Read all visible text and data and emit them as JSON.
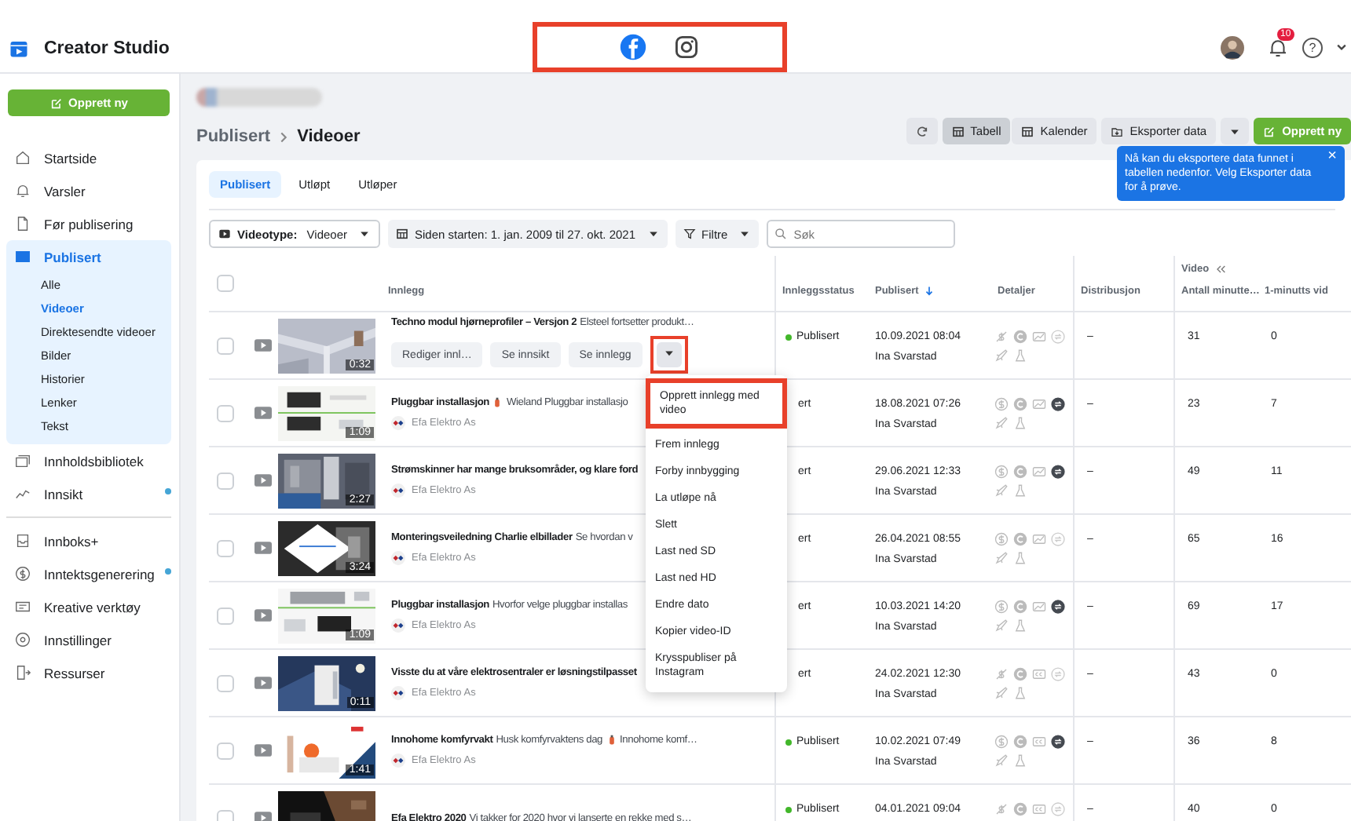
{
  "app": {
    "title": "Creator Studio"
  },
  "platform_switcher": {
    "highlighted": true
  },
  "platforms": [
    {
      "kind": "facebook",
      "selected": true
    },
    {
      "kind": "instagram",
      "selected": false
    }
  ],
  "header": {
    "notification_count": "10",
    "help_label": "?"
  },
  "sidebar": {
    "create_button": "Opprett ny",
    "items": [
      {
        "kind": "home",
        "label": "Startside",
        "selected": false,
        "badge": false
      },
      {
        "kind": "bell",
        "label": "Varsler",
        "selected": false,
        "badge": false
      },
      {
        "kind": "doc",
        "label": "Før publisering",
        "selected": false,
        "badge": false
      },
      {
        "kind": "publish",
        "label": "Publisert",
        "selected": true,
        "badge": false,
        "expanded": true,
        "children": [
          {
            "label": "Alle",
            "selected": false
          },
          {
            "label": "Videoer",
            "selected": true
          },
          {
            "label": "Direktesendte videoer",
            "selected": false
          },
          {
            "label": "Bilder",
            "selected": false
          },
          {
            "label": "Historier",
            "selected": false
          },
          {
            "label": "Lenker",
            "selected": false
          },
          {
            "label": "Tekst",
            "selected": false
          }
        ]
      },
      {
        "kind": "library",
        "label": "Innholdsbibliotek",
        "selected": false,
        "badge": false
      },
      {
        "kind": "insights",
        "label": "Innsikt",
        "selected": false,
        "badge": true
      },
      {
        "kind": "divider"
      },
      {
        "kind": "inbox",
        "label": "Innboks+",
        "selected": false,
        "badge": false
      },
      {
        "kind": "money",
        "label": "Inntektsgenerering",
        "selected": false,
        "badge": true
      },
      {
        "kind": "creative",
        "label": "Kreative verktøy",
        "selected": false,
        "badge": false
      },
      {
        "kind": "settings",
        "label": "Innstillinger",
        "selected": false,
        "badge": false
      },
      {
        "kind": "resources",
        "label": "Ressurser",
        "selected": false,
        "badge": false
      }
    ]
  },
  "breadcrumb": [
    "Publisert",
    "Videoer"
  ],
  "toolbar": {
    "views": [
      {
        "label": "Tabell",
        "selected": true
      },
      {
        "label": "Kalender",
        "selected": false
      }
    ],
    "export": "Eksporter data",
    "create": "Opprett ny"
  },
  "tooltip": {
    "text": "Nå kan du eksportere data funnet i tabellen nedenfor. Velg Eksporter data for å prøve.",
    "close": "×"
  },
  "tabs": [
    {
      "label": "Publisert",
      "selected": true
    },
    {
      "label": "Utløpt",
      "selected": false
    },
    {
      "label": "Utløper",
      "selected": false
    }
  ],
  "filters": [
    {
      "kind": "videotype",
      "label": "Videotype:",
      "value": "Videoer"
    },
    {
      "kind": "date",
      "value": "Siden starten: 1. jan. 2009 til 27. okt. 2021"
    },
    {
      "kind": "filter",
      "value": "Filtre"
    }
  ],
  "search": {
    "placeholder": "Søk"
  },
  "table": {
    "select_all": {
      "checked": false
    },
    "group_header": "Video",
    "columns": [
      {
        "label": "Innlegg",
        "sorted": false
      },
      {
        "label": "Innleggsstatus",
        "sorted": false
      },
      {
        "label": "Publisert",
        "sorted": true
      },
      {
        "label": "Detaljer",
        "sorted": false
      },
      {
        "label": "Distribusjon",
        "sorted": false
      },
      {
        "label": "Antall minutte…",
        "sorted": false
      },
      {
        "label": "1-minutts vid",
        "sorted": false
      }
    ],
    "rows": [
      {
        "checked": false,
        "duration": "0:32",
        "title": "Techno modul hjørneprofiler – Versjon 2",
        "segments": [
          {
            "kind": "text",
            "text": "Elsteel fortsetter produkt…"
          }
        ],
        "actions": [
          "Rediger innl…",
          "Se innsikt",
          "Se innlegg"
        ],
        "menu_button": {
          "highlighted": true
        },
        "status": "Publisert",
        "status_dot": true,
        "date": "10.09.2021 08:04",
        "publisher": "Ina Svarstad",
        "details": {
          "monetization": false,
          "captions": false,
          "crossposted": false
        },
        "distribution": "–",
        "minutes": "31",
        "one_minute": "0"
      },
      {
        "checked": false,
        "duration": "1:09",
        "title": "Pluggbar installasjon",
        "segments": [
          {
            "kind": "emoji"
          },
          {
            "kind": "text",
            "text": "Wieland Pluggbar installasjo"
          }
        ],
        "author": "Efa Elektro As",
        "status": "ert",
        "status_dot": false,
        "date": "18.08.2021 07:26",
        "publisher": "Ina Svarstad",
        "details": {
          "monetization": true,
          "captions": false,
          "crossposted": true
        },
        "distribution": "–",
        "minutes": "23",
        "one_minute": "7"
      },
      {
        "checked": false,
        "duration": "2:27",
        "title": "Strømskinner har mange bruksområder, og klare ford",
        "segments": [],
        "author": "Efa Elektro As",
        "status": "ert",
        "status_dot": false,
        "date": "29.06.2021 12:33",
        "publisher": "Ina Svarstad",
        "details": {
          "monetization": true,
          "captions": false,
          "crossposted": true
        },
        "distribution": "–",
        "minutes": "49",
        "one_minute": "11"
      },
      {
        "checked": false,
        "duration": "3:24",
        "title": "Monteringsveiledning Charlie elbillader",
        "segments": [
          {
            "kind": "text",
            "text": "Se hvordan v"
          }
        ],
        "author": "Efa Elektro As",
        "status": "ert",
        "status_dot": false,
        "date": "26.04.2021 08:55",
        "publisher": "Ina Svarstad",
        "details": {
          "monetization": true,
          "captions": false,
          "crossposted": false
        },
        "distribution": "–",
        "minutes": "65",
        "one_minute": "16"
      },
      {
        "checked": false,
        "duration": "1:09",
        "title": "Pluggbar installasjon",
        "segments": [
          {
            "kind": "text",
            "text": "Hvorfor velge pluggbar installas"
          }
        ],
        "author": "Efa Elektro As",
        "status": "ert",
        "status_dot": false,
        "date": "10.03.2021 14:20",
        "publisher": "Ina Svarstad",
        "details": {
          "monetization": true,
          "captions": false,
          "crossposted": true
        },
        "distribution": "–",
        "minutes": "69",
        "one_minute": "17"
      },
      {
        "checked": false,
        "duration": "0:11",
        "title": "Visste du at våre elektrosentraler er løsningstilpasset",
        "segments": [],
        "author": "Efa Elektro As",
        "status": "ert",
        "status_dot": false,
        "date": "24.02.2021 12:30",
        "publisher": "Ina Svarstad",
        "details": {
          "monetization": false,
          "captions": true,
          "crossposted": false
        },
        "distribution": "–",
        "minutes": "43",
        "one_minute": "0"
      },
      {
        "checked": false,
        "duration": "1:41",
        "title": "Innohome komfyrvakt",
        "segments": [
          {
            "kind": "text",
            "text": "Husk komfyrvaktens dag"
          },
          {
            "kind": "emoji"
          },
          {
            "kind": "text",
            "text": "Innohome komf…"
          }
        ],
        "author": "Efa Elektro As",
        "status": "Publisert",
        "status_dot": true,
        "date": "10.02.2021 07:49",
        "publisher": "Ina Svarstad",
        "details": {
          "monetization": true,
          "captions": true,
          "crossposted": true
        },
        "distribution": "–",
        "minutes": "36",
        "one_minute": "8"
      },
      {
        "checked": false,
        "title": "Efa Elektro 2020",
        "segments": [
          {
            "kind": "text",
            "text": "Vi takker for 2020 hvor vi lanserte en rekke med s…"
          }
        ],
        "status": "Publisert",
        "status_dot": true,
        "date": "04.01.2021 09:04",
        "details": {
          "monetization": false,
          "captions": true,
          "crossposted": false
        },
        "distribution": "–",
        "minutes": "40",
        "one_minute": "0"
      }
    ]
  },
  "menu": {
    "items": [
      {
        "label": "Opprett innlegg med video",
        "highlighted": true
      },
      {
        "label": "Frem innlegg",
        "highlighted": false
      },
      {
        "label": "Forby innbygging",
        "highlighted": false
      },
      {
        "label": "La utløpe nå",
        "highlighted": false
      },
      {
        "label": "Slett",
        "highlighted": false
      },
      {
        "label": "Last ned SD",
        "highlighted": false
      },
      {
        "label": "Last ned HD",
        "highlighted": false
      },
      {
        "label": "Endre dato",
        "highlighted": false
      },
      {
        "label": "Kopier video-ID",
        "highlighted": false
      },
      {
        "label": "Krysspubliser på Instagram",
        "highlighted": false
      }
    ]
  }
}
